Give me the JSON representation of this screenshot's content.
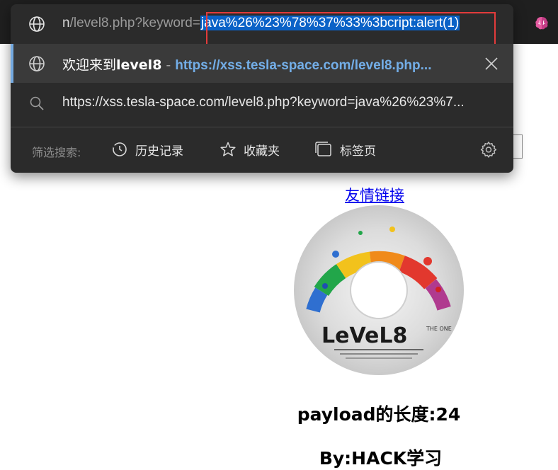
{
  "address_bar": {
    "prefix_dim": "n",
    "prefix_rest": "/level8.php?keyword=",
    "selected_text": "java%26%23%78%37%33%3bcript:alert(1)"
  },
  "suggestions": [
    {
      "title_normal": "欢迎来到",
      "title_bold": "level8",
      "separator": "-",
      "url": "https://xss.tesla-space.com/level8.php..."
    },
    {
      "search_text": "https://xss.tesla-space.com/level8.php?keyword=java%26%23%7..."
    }
  ],
  "filters": {
    "label": "筛选搜索:",
    "history": "历史记录",
    "favorites": "收藏夹",
    "tabs": "标签页"
  },
  "page": {
    "link_text": "友情链接",
    "disc_label": "LeVeL8",
    "disc_sub": "THE ONE",
    "payload_text": "payload的长度:24",
    "byline_text": "By:HACK学习"
  },
  "icons": {
    "globe": "globe-icon",
    "search": "search-icon",
    "close": "close-icon",
    "history": "history-icon",
    "star": "star-icon",
    "tabs": "tabs-icon",
    "gear": "gear-icon",
    "extension": "brain-extension-icon"
  },
  "colors": {
    "dropdown_bg": "#2b2b2b",
    "selection": "#0a62c7",
    "suggestion_url": "#73aee8",
    "highlight_box": "#e23b3b",
    "link": "#0000ee"
  }
}
